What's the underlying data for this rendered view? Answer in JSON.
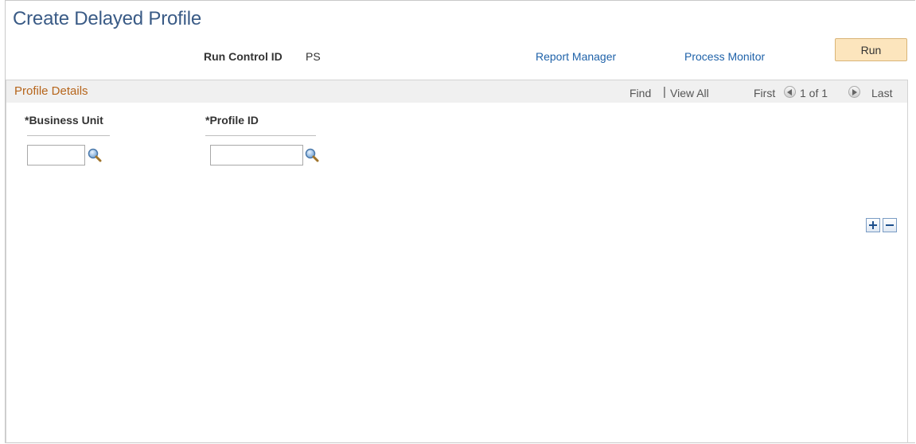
{
  "page": {
    "title": "Create Delayed Profile"
  },
  "run_control": {
    "label": "Run Control ID",
    "value": "PS"
  },
  "links": {
    "report_manager": "Report Manager",
    "process_monitor": "Process Monitor"
  },
  "run_button": {
    "label": "Run"
  },
  "grid": {
    "title": "Profile Details",
    "find": "Find",
    "separator": "|",
    "view_all": "View All",
    "first": "First",
    "count": "1 of 1",
    "last": "Last",
    "columns": [
      {
        "label": "*Business Unit",
        "value": ""
      },
      {
        "label": "*Profile ID",
        "value": ""
      }
    ]
  },
  "icons": {
    "lookup": "magnifying-glass-icon",
    "prev": "left-arrow-icon",
    "next": "right-arrow-icon",
    "add_row": "plus-icon",
    "delete_row": "minus-icon"
  },
  "colors": {
    "title": "#3a5b86",
    "link": "#1f62a9",
    "grid_title": "#b6651b",
    "run_button_bg": "#fce5bd",
    "grid_header_bg": "#f0f0f0"
  }
}
